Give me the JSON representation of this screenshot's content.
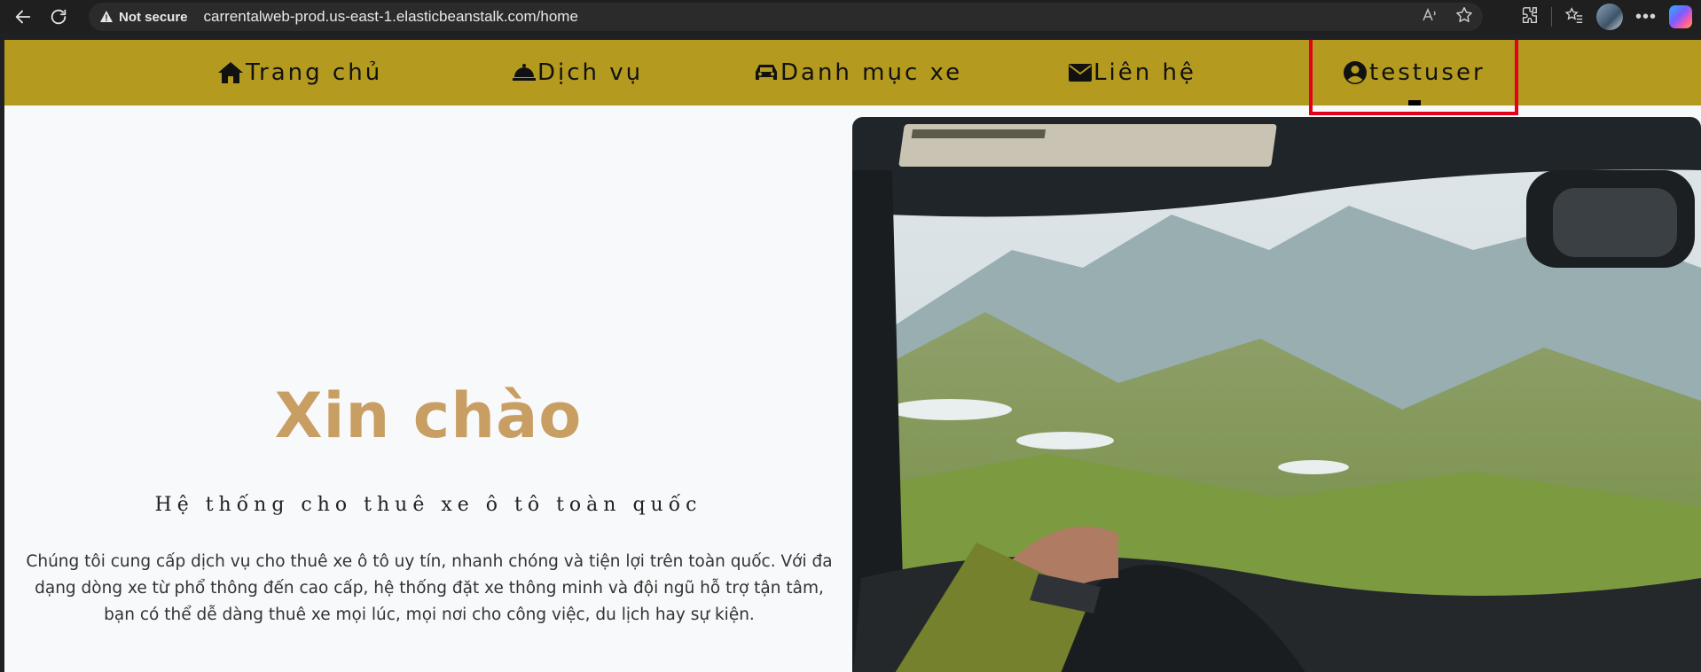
{
  "browser": {
    "security_label": "Not secure",
    "url": "carrentalweb-prod.us-east-1.elasticbeanstalk.com/home"
  },
  "navbar": {
    "items": [
      {
        "label": "Trang chủ",
        "icon": "home-icon"
      },
      {
        "label": "Dịch vụ",
        "icon": "service-bell-icon"
      },
      {
        "label": "Danh mục xe",
        "icon": "car-icon"
      },
      {
        "label": "Liên hệ",
        "icon": "envelope-icon"
      },
      {
        "label": "testuser",
        "icon": "user-circle-icon"
      }
    ],
    "color": "#b49a1f"
  },
  "hero": {
    "title": "Xin chào",
    "subtitle": "Hệ thống cho thuê xe ô tô toàn quốc",
    "description": "Chúng tôi cung cấp dịch vụ cho thuê xe ô tô uy tín, nhanh chóng và tiện lợi trên toàn quốc. Với đa dạng dòng xe từ phổ thông đến cao cấp, hệ thống đặt xe thông minh và đội ngũ hỗ trợ tận tâm, bạn có thể dễ dàng thuê xe mọi lúc, mọi nơi cho công việc, du lịch hay sự kiện.",
    "title_color": "#c89e63"
  },
  "highlight_color": "#e3001b"
}
